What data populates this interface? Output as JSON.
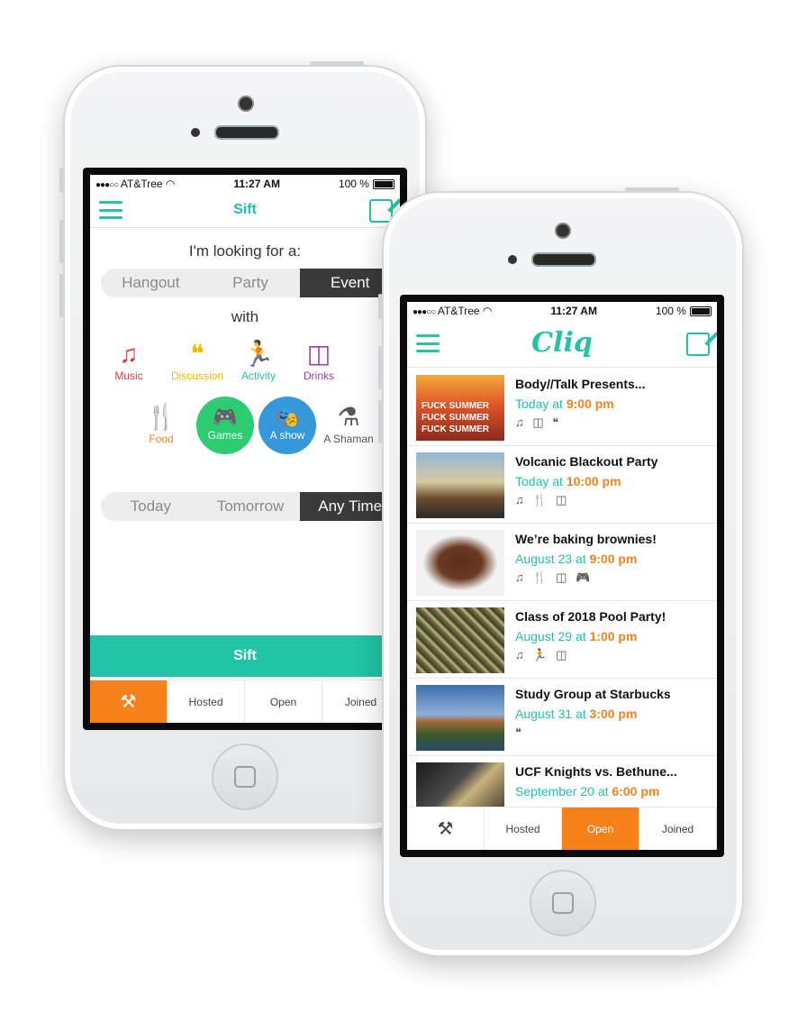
{
  "colors": {
    "accent": "#22c3a6",
    "orange": "#f7821b",
    "dark": "#3a3a3a",
    "music": "#e53935",
    "discussion": "#f5b700",
    "activity": "#22c3a6",
    "drinks": "#8e44ad",
    "food": "#f7821b",
    "games": "#2ecc71",
    "show": "#3498db"
  },
  "status": {
    "carrier": "AT&Tree",
    "signal": "●●●○○",
    "time": "11:27 AM",
    "battery": "100 %"
  },
  "sift": {
    "title": "Sift",
    "looking_for": "I'm looking for a:",
    "types": [
      "Hangout",
      "Party",
      "Event"
    ],
    "active_type": "Event",
    "with": "with",
    "categories": [
      {
        "label": "Music",
        "icon": "music-icon",
        "glyph": "♫"
      },
      {
        "label": "Discussion",
        "icon": "discussion-icon",
        "glyph": "❝"
      },
      {
        "label": "Activity",
        "icon": "activity-icon",
        "glyph": "🏃"
      },
      {
        "label": "Drinks",
        "icon": "drinks-icon",
        "glyph": "◫"
      },
      {
        "label": "Food",
        "icon": "food-icon",
        "glyph": "🍴"
      },
      {
        "label": "Games",
        "icon": "games-icon",
        "glyph": "🎮"
      },
      {
        "label": "A show",
        "icon": "show-icon",
        "glyph": "🎭"
      },
      {
        "label": "A Shaman",
        "icon": "shaman-icon",
        "glyph": "⚗"
      }
    ],
    "times": [
      "Today",
      "Tomorrow",
      "Any Time"
    ],
    "active_time": "Any Time",
    "sift_button": "Sift",
    "tabs": [
      "",
      "Hosted",
      "Open",
      "Joined"
    ],
    "active_tab": 0
  },
  "cliq": {
    "logo": "Cliq",
    "events": [
      {
        "title": "Body//Talk Presents...",
        "date": "Today at",
        "time": "9:00 pm",
        "icons": "♫ ◫ ❝"
      },
      {
        "title": "Volcanic Blackout Party",
        "date": "Today at",
        "time": "10:00 pm",
        "icons": "♫ 🍴 ◫"
      },
      {
        "title": "We’re baking brownies!",
        "date": "August 23 at",
        "time": "9:00 pm",
        "icons": "♫ 🍴 ◫ 🎮"
      },
      {
        "title": "Class of 2018 Pool Party!",
        "date": "August 29 at",
        "time": "1:00 pm",
        "icons": "♫ 🏃 ◫"
      },
      {
        "title": "Study Group at Starbucks",
        "date": "August 31 at",
        "time": "3:00 pm",
        "icons": "❝"
      },
      {
        "title": "UCF Knights vs. Bethune...",
        "date": "September 20 at",
        "time": "6:00 pm",
        "icons": ""
      }
    ],
    "thumb_text": "FUCK SUMMER",
    "tabs": [
      "",
      "Hosted",
      "Open",
      "Joined"
    ],
    "active_tab": 2
  }
}
